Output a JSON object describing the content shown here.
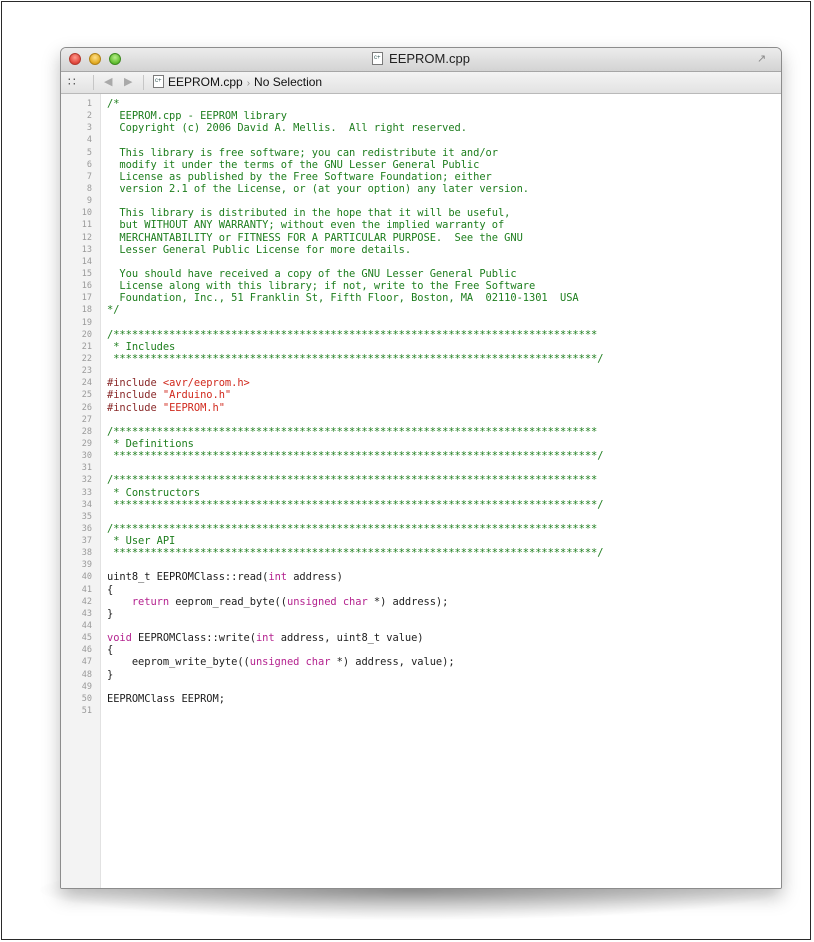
{
  "window": {
    "title": "EEPROM.cpp"
  },
  "jump_bar": {
    "file_name": "EEPROM.cpp",
    "selection": "No Selection"
  },
  "icons": {
    "close": "close-button",
    "minimize": "minimize-button",
    "zoom": "zoom-button",
    "file": "cpp-file-icon",
    "grid": "related-items-grid-icon",
    "back": "back-arrow-icon",
    "forward": "forward-arrow-icon",
    "fullscreen": "fullscreen-icon"
  },
  "colors": {
    "comment": "#1e7e1e",
    "preprocessor": "#8a2a2a",
    "string": "#d12a1e",
    "keyword": "#b4238f",
    "text": "#1e1e1e"
  },
  "code_lines": [
    {
      "n": "1",
      "segments": [
        {
          "t": "/*",
          "c": "comment"
        }
      ]
    },
    {
      "n": "2",
      "segments": [
        {
          "t": "  EEPROM.cpp - EEPROM library",
          "c": "comment"
        }
      ]
    },
    {
      "n": "3",
      "segments": [
        {
          "t": "  Copyright (c) 2006 David A. Mellis.  All right reserved.",
          "c": "comment"
        }
      ]
    },
    {
      "n": "4",
      "segments": []
    },
    {
      "n": "5",
      "segments": [
        {
          "t": "  This library is free software; you can redistribute it and/or",
          "c": "comment"
        }
      ]
    },
    {
      "n": "6",
      "segments": [
        {
          "t": "  modify it under the terms of the GNU Lesser General Public",
          "c": "comment"
        }
      ]
    },
    {
      "n": "7",
      "segments": [
        {
          "t": "  License as published by the Free Software Foundation; either",
          "c": "comment"
        }
      ]
    },
    {
      "n": "8",
      "segments": [
        {
          "t": "  version 2.1 of the License, or (at your option) any later version.",
          "c": "comment"
        }
      ]
    },
    {
      "n": "9",
      "segments": []
    },
    {
      "n": "10",
      "segments": [
        {
          "t": "  This library is distributed in the hope that it will be useful,",
          "c": "comment"
        }
      ]
    },
    {
      "n": "11",
      "segments": [
        {
          "t": "  but WITHOUT ANY WARRANTY; without even the implied warranty of",
          "c": "comment"
        }
      ]
    },
    {
      "n": "12",
      "segments": [
        {
          "t": "  MERCHANTABILITY or FITNESS FOR A PARTICULAR PURPOSE.  See the GNU",
          "c": "comment"
        }
      ]
    },
    {
      "n": "13",
      "segments": [
        {
          "t": "  Lesser General Public License for more details.",
          "c": "comment"
        }
      ]
    },
    {
      "n": "14",
      "segments": []
    },
    {
      "n": "15",
      "segments": [
        {
          "t": "  You should have received a copy of the GNU Lesser General Public",
          "c": "comment"
        }
      ]
    },
    {
      "n": "16",
      "segments": [
        {
          "t": "  License along with this library; if not, write to the Free Software",
          "c": "comment"
        }
      ]
    },
    {
      "n": "17",
      "segments": [
        {
          "t": "  Foundation, Inc., 51 Franklin St, Fifth Floor, Boston, MA  02110-1301  USA",
          "c": "comment"
        }
      ]
    },
    {
      "n": "18",
      "segments": [
        {
          "t": "*/",
          "c": "comment"
        }
      ]
    },
    {
      "n": "19",
      "segments": []
    },
    {
      "n": "20",
      "segments": [
        {
          "t": "/******************************************************************************",
          "c": "comment"
        }
      ]
    },
    {
      "n": "21",
      "segments": [
        {
          "t": " * Includes",
          "c": "comment"
        }
      ]
    },
    {
      "n": "22",
      "segments": [
        {
          "t": " ******************************************************************************/",
          "c": "comment"
        }
      ]
    },
    {
      "n": "23",
      "segments": []
    },
    {
      "n": "24",
      "segments": [
        {
          "t": "#include ",
          "c": "pre"
        },
        {
          "t": "<avr/eeprom.h>",
          "c": "str"
        }
      ]
    },
    {
      "n": "25",
      "segments": [
        {
          "t": "#include ",
          "c": "pre"
        },
        {
          "t": "\"Arduino.h\"",
          "c": "str"
        }
      ]
    },
    {
      "n": "26",
      "segments": [
        {
          "t": "#include ",
          "c": "pre"
        },
        {
          "t": "\"EEPROM.h\"",
          "c": "str"
        }
      ]
    },
    {
      "n": "27",
      "segments": []
    },
    {
      "n": "28",
      "segments": [
        {
          "t": "/******************************************************************************",
          "c": "comment"
        }
      ]
    },
    {
      "n": "29",
      "segments": [
        {
          "t": " * Definitions",
          "c": "comment"
        }
      ]
    },
    {
      "n": "30",
      "segments": [
        {
          "t": " ******************************************************************************/",
          "c": "comment"
        }
      ]
    },
    {
      "n": "31",
      "segments": []
    },
    {
      "n": "32",
      "segments": [
        {
          "t": "/******************************************************************************",
          "c": "comment"
        }
      ]
    },
    {
      "n": "33",
      "segments": [
        {
          "t": " * Constructors",
          "c": "comment"
        }
      ]
    },
    {
      "n": "34",
      "segments": [
        {
          "t": " ******************************************************************************/",
          "c": "comment"
        }
      ]
    },
    {
      "n": "35",
      "segments": []
    },
    {
      "n": "36",
      "segments": [
        {
          "t": "/******************************************************************************",
          "c": "comment"
        }
      ]
    },
    {
      "n": "37",
      "segments": [
        {
          "t": " * User API",
          "c": "comment"
        }
      ]
    },
    {
      "n": "38",
      "segments": [
        {
          "t": " ******************************************************************************/",
          "c": "comment"
        }
      ]
    },
    {
      "n": "39",
      "segments": []
    },
    {
      "n": "40",
      "segments": [
        {
          "t": "uint8_t EEPROMClass::read(",
          "c": ""
        },
        {
          "t": "int",
          "c": "kw"
        },
        {
          "t": " address)",
          "c": ""
        }
      ]
    },
    {
      "n": "41",
      "segments": [
        {
          "t": "{",
          "c": ""
        }
      ]
    },
    {
      "n": "42",
      "segments": [
        {
          "t": "    ",
          "c": ""
        },
        {
          "t": "return",
          "c": "kw"
        },
        {
          "t": " eeprom_read_byte((",
          "c": ""
        },
        {
          "t": "unsigned char",
          "c": "kw"
        },
        {
          "t": " *) address);",
          "c": ""
        }
      ]
    },
    {
      "n": "43",
      "segments": [
        {
          "t": "}",
          "c": ""
        }
      ]
    },
    {
      "n": "44",
      "segments": []
    },
    {
      "n": "45",
      "segments": [
        {
          "t": "void",
          "c": "kw"
        },
        {
          "t": " EEPROMClass::write(",
          "c": ""
        },
        {
          "t": "int",
          "c": "kw"
        },
        {
          "t": " address, uint8_t value)",
          "c": ""
        }
      ]
    },
    {
      "n": "46",
      "segments": [
        {
          "t": "{",
          "c": ""
        }
      ]
    },
    {
      "n": "47",
      "segments": [
        {
          "t": "    eeprom_write_byte((",
          "c": ""
        },
        {
          "t": "unsigned char",
          "c": "kw"
        },
        {
          "t": " *) address, value);",
          "c": ""
        }
      ]
    },
    {
      "n": "48",
      "segments": [
        {
          "t": "}",
          "c": ""
        }
      ]
    },
    {
      "n": "49",
      "segments": []
    },
    {
      "n": "50",
      "segments": [
        {
          "t": "EEPROMClass EEPROM;",
          "c": ""
        }
      ]
    },
    {
      "n": "51",
      "segments": []
    }
  ]
}
